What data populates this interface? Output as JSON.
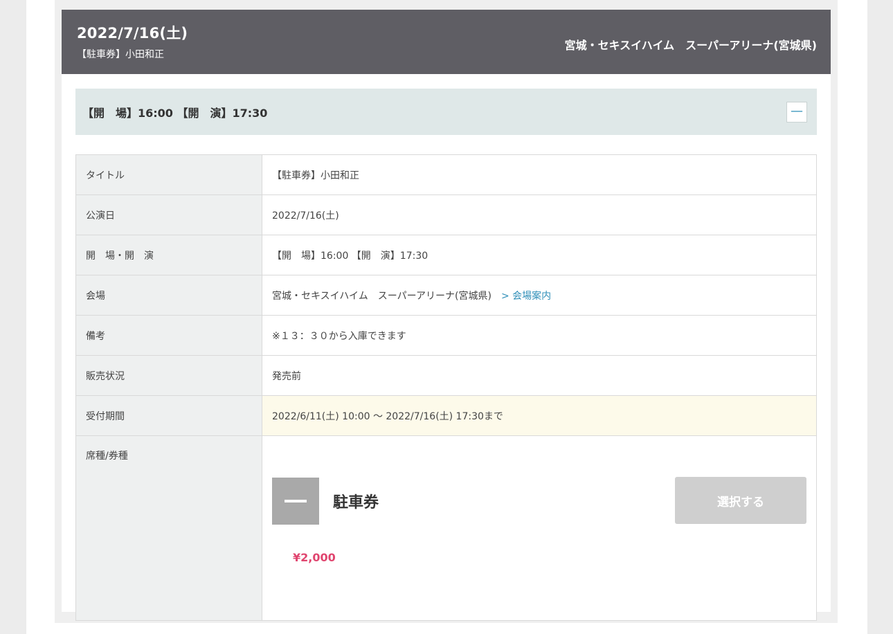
{
  "event": {
    "date": "2022/7/16(土)",
    "subtitle": "【駐車券】小田和正",
    "venue": "宮城・セキスイハイム　スーパーアリーナ(宮城県)"
  },
  "time_bar": {
    "text": "【開　場】16:00 【開　演】17:30",
    "collapse_label": "—"
  },
  "details": {
    "title": {
      "label": "タイトル",
      "value": "【駐車券】小田和正"
    },
    "date": {
      "label": "公演日",
      "value": "2022/7/16(土)"
    },
    "times": {
      "label": "開　場・開　演",
      "value": "【開　場】16:00 【開　演】17:30"
    },
    "venue": {
      "label": "会場",
      "value": "宮城・セキスイハイム　スーパーアリーナ(宮城県)",
      "link": "> 会場案内"
    },
    "notes": {
      "label": "備考",
      "value": "※１３：３０から入庫できます"
    },
    "status": {
      "label": "販売状況",
      "value": "発売前"
    },
    "period": {
      "label": "受付期間",
      "value": "2022/6/11(土) 10:00 ～ 2022/7/16(土) 17:30まで"
    },
    "seat": {
      "label": "席種/券種"
    }
  },
  "seat_type": {
    "name": "駐車券",
    "select_label": "選択する",
    "price": "¥2,000"
  },
  "colors": {
    "header_bg": "#5f5e64",
    "time_bar_bg": "#dfe8e8",
    "highlight_bg": "#fdfaea",
    "link": "#2f8fb8",
    "price": "#e0456f",
    "button_disabled": "#cfcfcf"
  },
  "icons": {
    "collapse": "minus-icon",
    "seat": "minus-square-icon",
    "link": "chevron-right-icon"
  }
}
